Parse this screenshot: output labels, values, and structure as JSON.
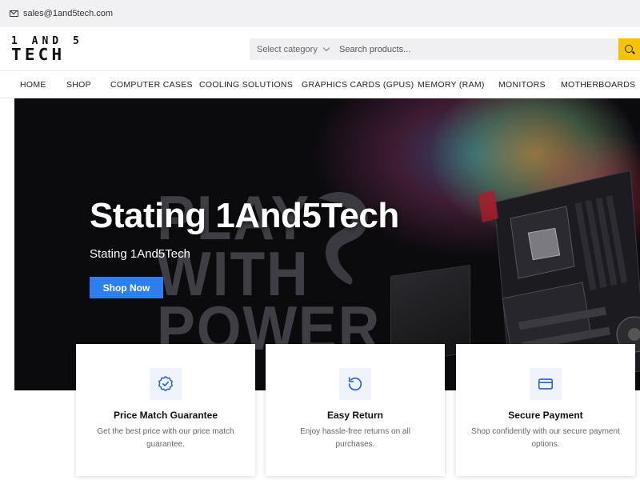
{
  "topbar": {
    "email": "sales@1and5tech.com",
    "icon": "mail-icon"
  },
  "logo": {
    "line1": "1 AND 5",
    "line2": "TECH"
  },
  "search": {
    "category": "Select category",
    "placeholder": "Search products...",
    "button_color": "#f7c200"
  },
  "nav": [
    "HOME",
    "SHOP",
    "COMPUTER CASES",
    "COOLING SOLUTIONS",
    "GRAPHICS CARDS (GPUS)",
    "MEMORY (RAM)",
    "MONITORS",
    "MOTHERBOARDS"
  ],
  "hero": {
    "title": "Stating 1And5Tech",
    "subtitle": "Stating 1And5Tech",
    "button": "Shop Now",
    "button_color": "#2d7ff0",
    "background_words": [
      "PLAY",
      "WITH",
      "POWER"
    ]
  },
  "features": [
    {
      "icon": "badge-check-icon",
      "title": "Price Match Guarantee",
      "desc": "Get the best price with our price match guarantee."
    },
    {
      "icon": "rotate-ccw-icon",
      "title": "Easy Return",
      "desc": "Enjoy hassle-free returns on all purchases."
    },
    {
      "icon": "credit-card-icon",
      "title": "Secure Payment",
      "desc": "Shop confidently with our secure payment options."
    }
  ]
}
